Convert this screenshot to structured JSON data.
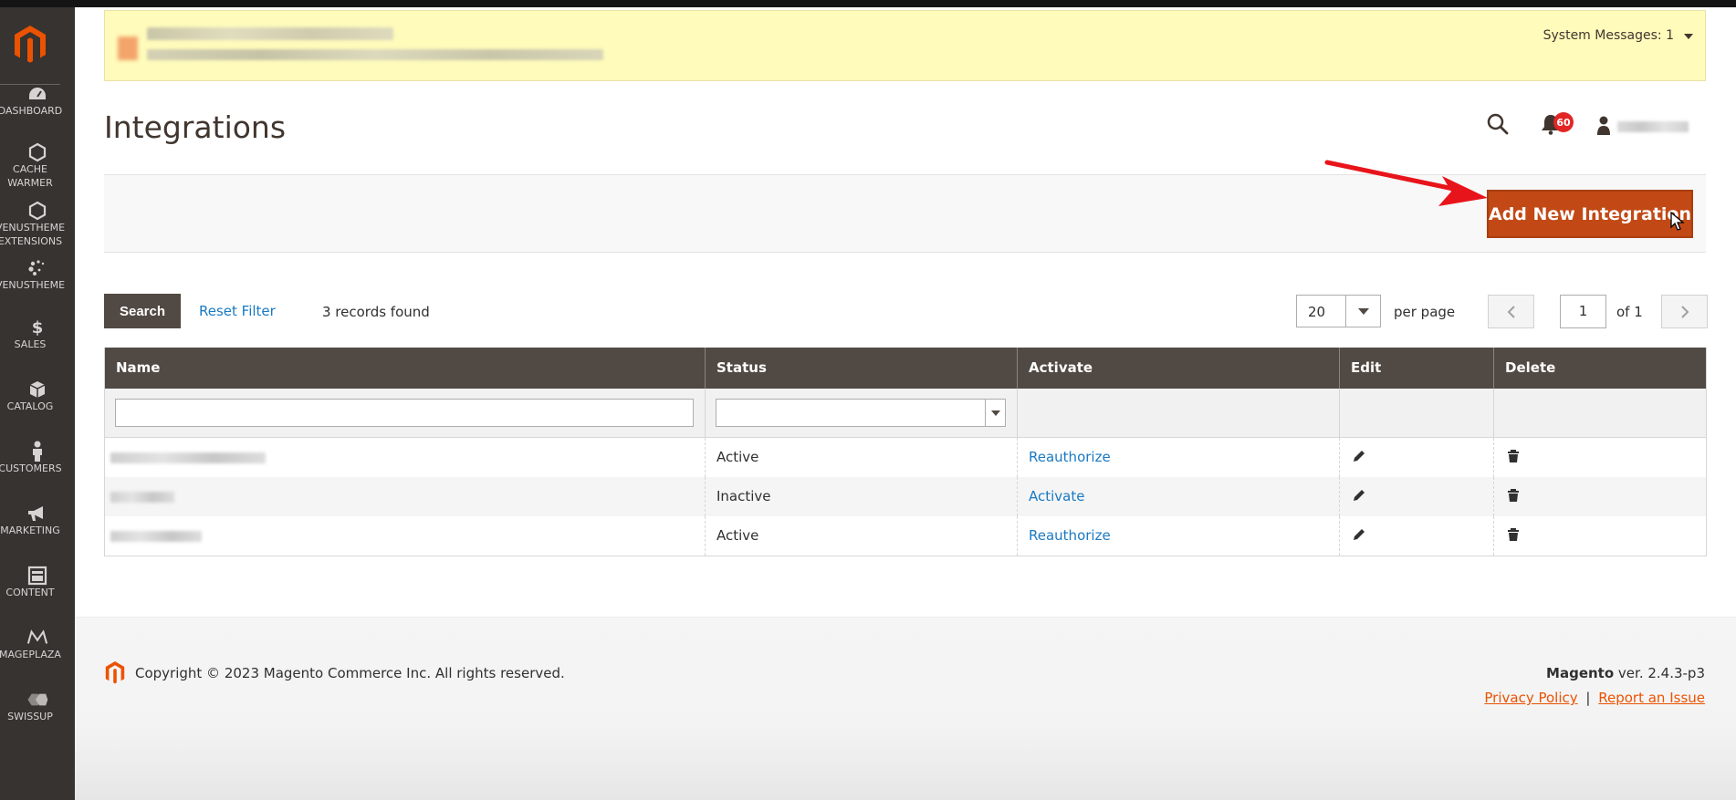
{
  "system_messages": {
    "label": "System Messages: 1"
  },
  "page": {
    "title": "Integrations"
  },
  "header": {
    "notifications_count": "60"
  },
  "sidebar": {
    "items": [
      {
        "label": "DASHBOARD",
        "icon": "dashboard-icon"
      },
      {
        "label": "CACHE\nWARMER",
        "icon": "hexagon-icon"
      },
      {
        "label": "VENUSTHEME\nEXTENSIONS",
        "icon": "hexagon-icon"
      },
      {
        "label": "VENUSTHEME",
        "icon": "dots-icon"
      },
      {
        "label": "SALES",
        "icon": "dollar-icon"
      },
      {
        "label": "CATALOG",
        "icon": "box-icon"
      },
      {
        "label": "CUSTOMERS",
        "icon": "person-icon"
      },
      {
        "label": "MARKETING",
        "icon": "megaphone-icon"
      },
      {
        "label": "CONTENT",
        "icon": "layout-icon"
      },
      {
        "label": "MAGEPLAZA",
        "icon": "mageplaza-icon"
      },
      {
        "label": "SWISSUP",
        "icon": "swissup-icon"
      }
    ]
  },
  "actions": {
    "add_button": "Add New Integration"
  },
  "grid": {
    "search_button": "Search",
    "reset_filter": "Reset Filter",
    "records_found": "3 records found",
    "per_page_value": "20",
    "per_page_label": "per page",
    "current_page": "1",
    "of_pages": "of 1",
    "columns": [
      "Name",
      "Status",
      "Activate",
      "Edit",
      "Delete"
    ],
    "rows": [
      {
        "status": "Active",
        "activate": "Reauthorize"
      },
      {
        "status": "Inactive",
        "activate": "Activate"
      },
      {
        "status": "Active",
        "activate": "Reauthorize"
      }
    ]
  },
  "footer": {
    "copyright": "Copyright © 2023 Magento Commerce Inc. All rights reserved.",
    "brand": "Magento",
    "version": " ver. 2.4.3-p3",
    "privacy_policy": "Privacy Policy",
    "separator": "|",
    "report_issue": "Report an Issue"
  },
  "colors": {
    "sidebar_bg": "#373330",
    "accent_orange": "#eb5202",
    "button_primary": "#c24915",
    "table_header": "#514943",
    "link": "#1979c3",
    "notice_bg": "#fffbbb",
    "arrow": "#e8141b"
  }
}
